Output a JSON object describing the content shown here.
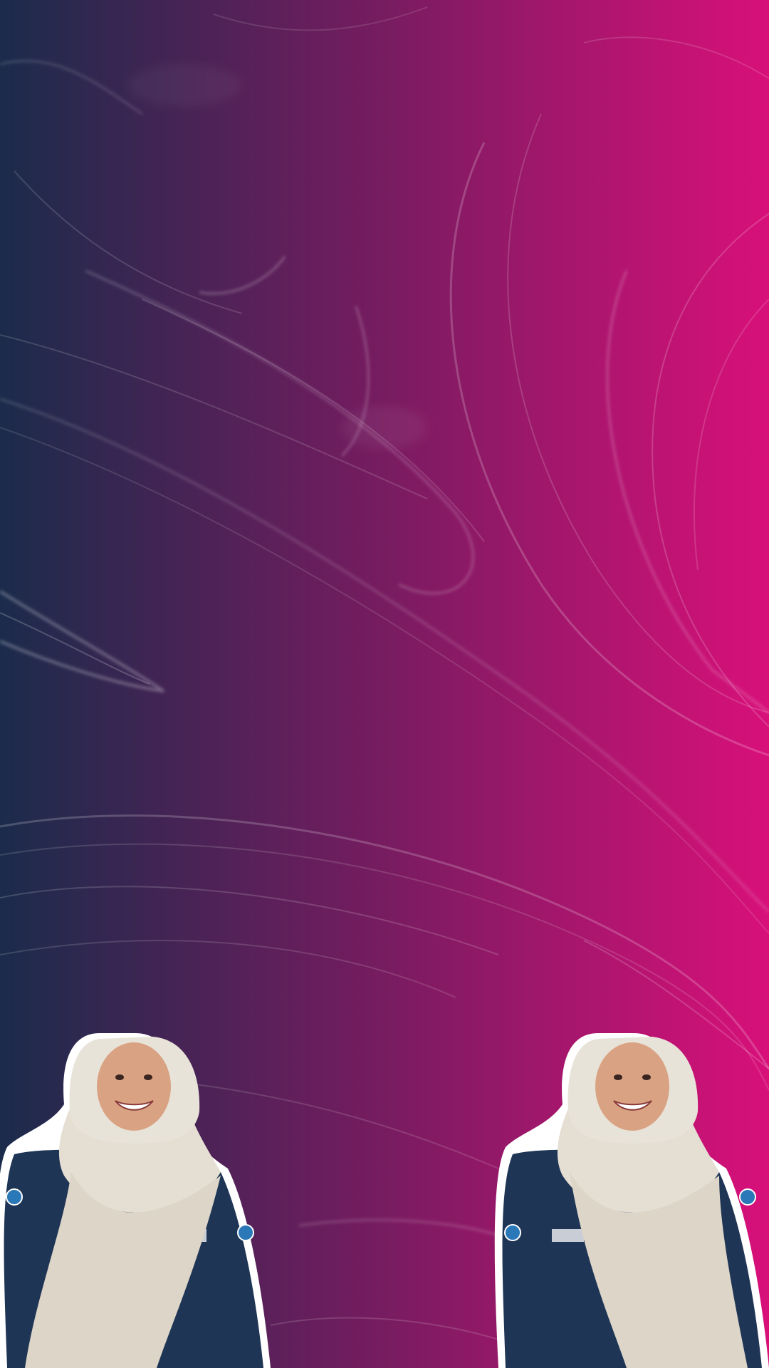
{
  "scene": {
    "background": {
      "type": "swirl-gradient",
      "color_left": "#1b2b4b",
      "color_mid": "#6e1d5e",
      "color_right": "#d8107a",
      "swirl_color": "#ffffff"
    },
    "people": [
      {
        "name": "person-left",
        "hijab_color": "#e4ded3",
        "uniform_color": "#1f3555",
        "skin_color": "#d9a383",
        "outline_color": "#ffffff"
      },
      {
        "name": "person-right",
        "hijab_color": "#e4ded3",
        "uniform_color": "#1f3555",
        "skin_color": "#d9a383",
        "outline_color": "#ffffff"
      }
    ]
  }
}
